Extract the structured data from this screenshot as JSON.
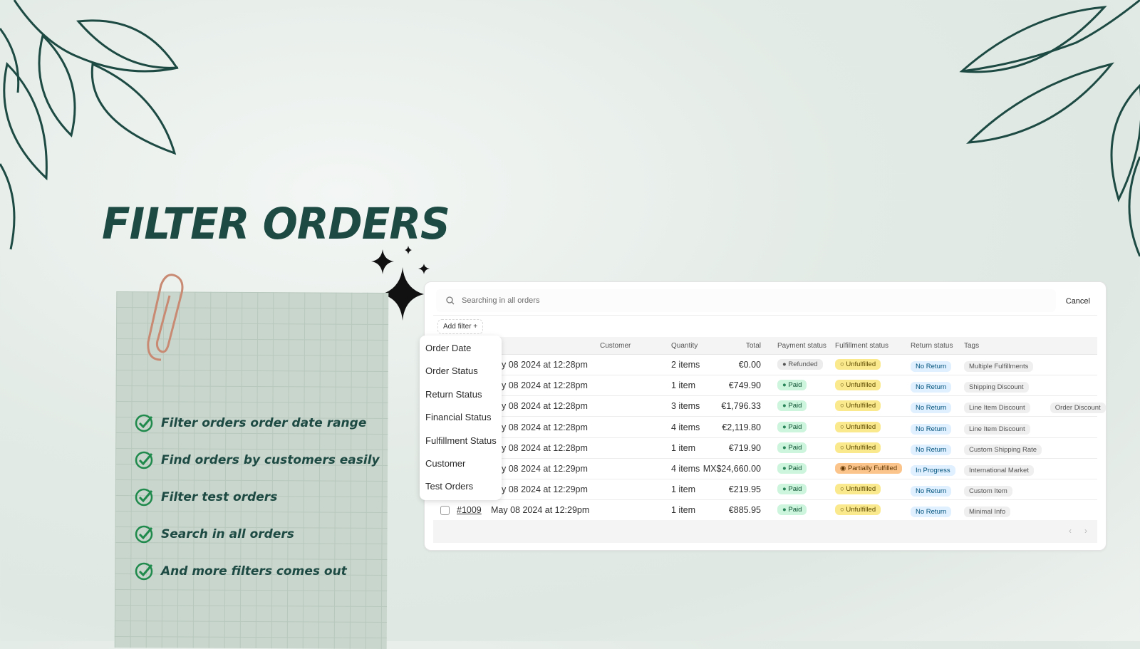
{
  "heading": "FILTER ORDERS",
  "checklist": [
    "Filter orders order date range",
    "Find orders by customers easily",
    "Filter test orders",
    "Search in all orders",
    "And more filters comes out"
  ],
  "colors": {
    "brand": "#1d4a43",
    "paid": "#cdf5dd",
    "unfulfilled": "#fbe98e",
    "partial": "#fbc48a",
    "refunded": "#ececec",
    "return": "#e0f0ff",
    "tag": "#efefef"
  },
  "search": {
    "placeholder": "Searching in all orders",
    "cancel": "Cancel",
    "add_filter": "Add filter +"
  },
  "columns": {
    "date": "e",
    "customer": "Customer",
    "quantity": "Quantity",
    "total": "Total",
    "payment": "Payment status",
    "fulfillment": "Fulfillment status",
    "return": "Return status",
    "tags": "Tags"
  },
  "filter_menu": [
    "Order Date",
    "Order Status",
    "Return Status",
    "Financial Status",
    "Fulfillment Status",
    "Customer",
    "Test Orders"
  ],
  "rows": [
    {
      "order": "",
      "date": "y 08 2024 at 12:28pm",
      "quantity": "2 items",
      "total": "€0.00",
      "payment": "Refunded",
      "fulfillment": "Unfulfilled",
      "return": "No Return",
      "tags": [
        "Multiple Fulfillments"
      ]
    },
    {
      "order": "",
      "date": "y 08 2024 at 12:28pm",
      "quantity": "1 item",
      "total": "€749.90",
      "payment": "Paid",
      "fulfillment": "Unfulfilled",
      "return": "No Return",
      "tags": [
        "Shipping Discount"
      ]
    },
    {
      "order": "",
      "date": "y 08 2024 at 12:28pm",
      "quantity": "3 items",
      "total": "€1,796.33",
      "payment": "Paid",
      "fulfillment": "Unfulfilled",
      "return": "No Return",
      "tags": [
        "Line Item Discount",
        "Order Discount"
      ]
    },
    {
      "order": "",
      "date": "y 08 2024 at 12:28pm",
      "quantity": "4 items",
      "total": "€2,119.80",
      "payment": "Paid",
      "fulfillment": "Unfulfilled",
      "return": "No Return",
      "tags": [
        "Line Item Discount"
      ]
    },
    {
      "order": "",
      "date": "y 08 2024 at 12:28pm",
      "quantity": "1 item",
      "total": "€719.90",
      "payment": "Paid",
      "fulfillment": "Unfulfilled",
      "return": "No Return",
      "tags": [
        "Custom Shipping Rate"
      ]
    },
    {
      "order": "",
      "date": "y 08 2024 at 12:29pm",
      "quantity": "4 items",
      "total": "MX$24,660.00",
      "payment": "Paid",
      "fulfillment": "Partially Fulfilled",
      "return": "In Progress",
      "tags": [
        "International Market"
      ]
    },
    {
      "order": "",
      "date": "y 08 2024 at 12:29pm",
      "quantity": "1 item",
      "total": "€219.95",
      "payment": "Paid",
      "fulfillment": "Unfulfilled",
      "return": "No Return",
      "tags": [
        "Custom Item"
      ]
    },
    {
      "order": "#1009",
      "date": "May 08 2024 at 12:29pm",
      "quantity": "1 item",
      "total": "€885.95",
      "payment": "Paid",
      "fulfillment": "Unfulfilled",
      "return": "No Return",
      "tags": [
        "Minimal Info"
      ]
    }
  ]
}
